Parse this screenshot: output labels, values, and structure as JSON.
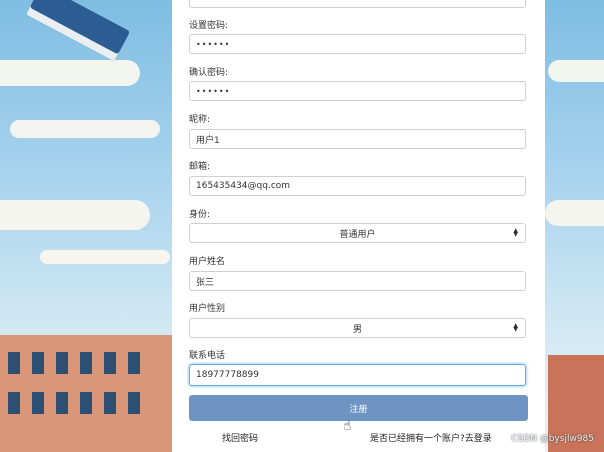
{
  "form": {
    "password_label": "设置密码:",
    "password_value": "••••••",
    "confirm_label": "确认密码:",
    "confirm_value": "••••••",
    "nickname_label": "昵称:",
    "nickname_value": "用户1",
    "email_label": "邮箱:",
    "email_value": "165435434@qq.com",
    "identity_label": "身份:",
    "identity_value": "普通用户",
    "realname_label": "用户姓名",
    "realname_value": "张三",
    "gender_label": "用户性别",
    "gender_value": "男",
    "phone_label": "联系电话",
    "phone_value": "18977778899"
  },
  "actions": {
    "register_label": "注册",
    "find_password_label": "找回密码",
    "login_link_label": "是否已经拥有一个账户?去登录"
  },
  "watermark": "CSDN @bysjlw985",
  "colors": {
    "primary_button": "#6e94c3",
    "focus_border": "#66afe9"
  }
}
